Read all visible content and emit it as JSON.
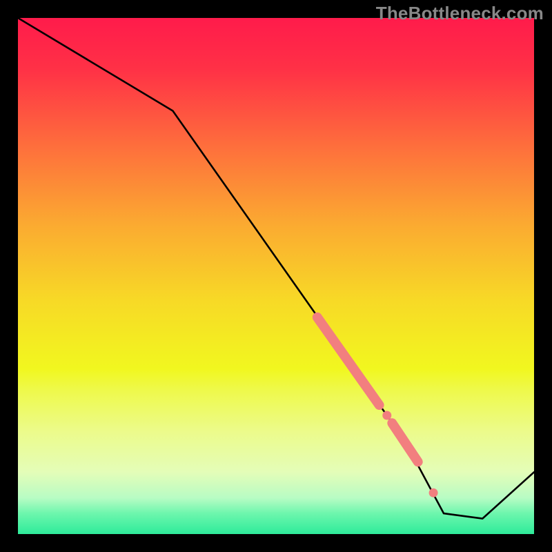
{
  "watermark": "TheBottleneck.com",
  "chart_data": {
    "type": "line",
    "title": "",
    "xlabel": "",
    "ylabel": "",
    "xlim": [
      0,
      100
    ],
    "ylim": [
      0,
      100
    ],
    "background_gradient": {
      "stops": [
        {
          "pct": 0,
          "color": "#ff1b4b"
        },
        {
          "pct": 10,
          "color": "#ff3146"
        },
        {
          "pct": 25,
          "color": "#fe6f3c"
        },
        {
          "pct": 40,
          "color": "#fbaa31"
        },
        {
          "pct": 55,
          "color": "#f7da26"
        },
        {
          "pct": 68,
          "color": "#f1f71f"
        },
        {
          "pct": 72,
          "color": "#eef94a"
        },
        {
          "pct": 80,
          "color": "#ecfb8a"
        },
        {
          "pct": 88,
          "color": "#e4fdb8"
        },
        {
          "pct": 93,
          "color": "#b8fcc4"
        },
        {
          "pct": 96,
          "color": "#6df6ad"
        },
        {
          "pct": 100,
          "color": "#2eeb9a"
        }
      ]
    },
    "series": [
      {
        "name": "bottleneck-curve",
        "color": "#000000",
        "x": [
          0,
          30,
          75,
          82.5,
          90,
          100
        ],
        "values": [
          100,
          82,
          18,
          4,
          3,
          12
        ]
      },
      {
        "name": "highlight-band",
        "color": "#f27f7f",
        "style": "thick-segments",
        "x": [
          58,
          70
        ],
        "values": [
          42,
          25
        ]
      },
      {
        "name": "highlight-dot-1",
        "color": "#f27f7f",
        "style": "dot",
        "x": [
          71.5
        ],
        "values": [
          23
        ]
      },
      {
        "name": "highlight-band-2",
        "color": "#f27f7f",
        "style": "thick-segments",
        "x": [
          72.5,
          77.5
        ],
        "values": [
          21.5,
          14
        ]
      },
      {
        "name": "highlight-dot-2",
        "color": "#f27f7f",
        "style": "dot",
        "x": [
          80.5
        ],
        "values": [
          8
        ]
      }
    ]
  }
}
